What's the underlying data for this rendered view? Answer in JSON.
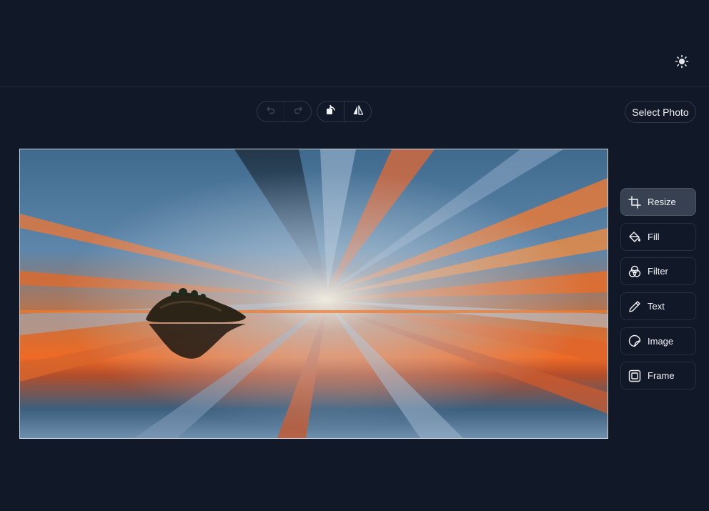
{
  "header": {
    "theme_toggle_icon": "sun-icon"
  },
  "toolbar": {
    "undo_icon": "undo-icon",
    "redo_icon": "redo-icon",
    "rotate_icon": "rotate-icon",
    "flip_icon": "flip-horizontal-icon",
    "select_photo_label": "Select Photo"
  },
  "canvas": {
    "image_subject": "island-sunset-reflection-photo"
  },
  "tools": {
    "items": [
      {
        "label": "Resize",
        "icon": "crop-icon",
        "active": true
      },
      {
        "label": "Fill",
        "icon": "paint-bucket-icon",
        "active": false
      },
      {
        "label": "Filter",
        "icon": "filter-circles-icon",
        "active": false
      },
      {
        "label": "Text",
        "icon": "pencil-icon",
        "active": false
      },
      {
        "label": "Image",
        "icon": "sticker-icon",
        "active": false
      },
      {
        "label": "Frame",
        "icon": "frame-icon",
        "active": false
      }
    ]
  },
  "colors": {
    "background": "#111827",
    "panel_border": "#263041",
    "active_tool": "#374151",
    "text": "#f3f4f6"
  }
}
